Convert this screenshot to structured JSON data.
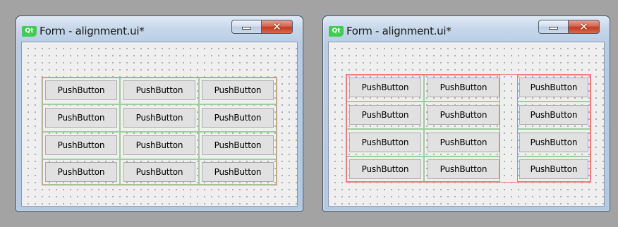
{
  "windows": [
    {
      "app_icon": "qt-icon",
      "app_icon_text": "Qt",
      "title": "Form - alignment.ui*",
      "buttons": [
        [
          "PushButton",
          "PushButton",
          "PushButton"
        ],
        [
          "PushButton",
          "PushButton",
          "PushButton"
        ],
        [
          "PushButton",
          "PushButton",
          "PushButton"
        ],
        [
          "PushButton",
          "PushButton",
          "PushButton"
        ]
      ]
    },
    {
      "app_icon": "qt-icon",
      "app_icon_text": "Qt",
      "title": "Form - alignment.ui*",
      "buttons": [
        [
          "PushButton",
          "PushButton",
          "PushButton"
        ],
        [
          "PushButton",
          "PushButton",
          "PushButton"
        ],
        [
          "PushButton",
          "PushButton",
          "PushButton"
        ],
        [
          "PushButton",
          "PushButton",
          "PushButton"
        ]
      ]
    }
  ],
  "colors": {
    "desktop": "#a3a3a3",
    "layout_border": "#f07b7b",
    "cell_border": "#9ccf9c",
    "close_button": "#c23b21"
  },
  "icons": {
    "minimize": "minimize-icon",
    "close": "close-icon"
  },
  "close_glyph": "✕"
}
